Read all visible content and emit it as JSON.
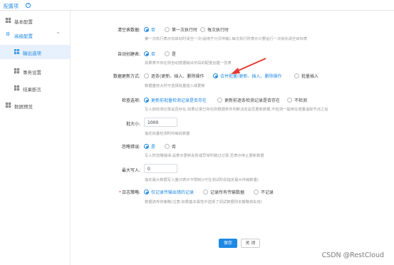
{
  "header": {
    "title": "配置项",
    "info_icon": "info-icon"
  },
  "sidebar": {
    "items": [
      {
        "label": "基本配置",
        "icon": "grid-icon"
      },
      {
        "label": "高级配置",
        "icon": "settings-icon",
        "chevron": "^"
      },
      {
        "label": "输出选项",
        "icon": "grid-icon"
      },
      {
        "label": "事务设置",
        "icon": "grid-icon"
      },
      {
        "label": "结果断言",
        "icon": "grid-icon"
      },
      {
        "label": "数据预览",
        "icon": "grid-icon"
      }
    ]
  },
  "form": {
    "truncate": {
      "label": "清空表数据:",
      "options": [
        "否",
        "第一次执行时",
        "每次执行时"
      ],
      "selected": 0,
      "hint": "第一次执行表示仅启动时清空一次(适用于分页传输),每次执行时表示只要运行一次就先清空目标表"
    },
    "auto_create": {
      "label": "自动创建表:",
      "options": [
        "否",
        "是"
      ],
      "selected": 0,
      "hint": "如果表不存在则自动根据输出字段的配置创建一张表"
    },
    "update_mode": {
      "label": "数据更新方式:",
      "options": [
        "逐条(更新、插入、删除操作",
        "合并批量(更新、插入、删除操作",
        "批量插入"
      ],
      "selected": 1,
      "hint": "数据量较大时可选择批量插入或更新"
    },
    "check_option": {
      "label": "检查选项:",
      "options": [
        "更新前批量检测记录是否存在",
        "更新前逐条检测记录是否存在",
        "不检测"
      ],
      "selected": 0,
      "hint": "写入前检测记录是否存在,如果记录已存在则根据条件判断决定是否更新数据,不检测一般用在增量追踪节点之后"
    },
    "batch_size": {
      "label": "批大小:",
      "value": "1000",
      "hint": "指定批量检测时的每批数量"
    },
    "ignore_error": {
      "label": "忽略错误:",
      "options": [
        "是",
        "否"
      ],
      "selected": 0,
      "hint": "写入时忽略错误,是表示更新失败或异常时跳过记录,否表示停止更新数据"
    },
    "max_write": {
      "label": "最大写入:",
      "value": "0",
      "hint": "指定最大数据写入量(0表示不限制)(可在测试阶段指定最大传输数量)"
    },
    "log_policy": {
      "label": "日志策略:",
      "required": "*",
      "options": [
        "仅记录传输出错的记录",
        "记录所有传输数据",
        "不记录"
      ],
      "selected": 0,
      "hint": "数据流传存策略(注意:如果基本属性中选择了调试数据则本策略将失效)"
    }
  },
  "buttons": {
    "save": "保存",
    "close": "关 闭"
  },
  "watermark": "CSDN @RestCloud",
  "colors": {
    "accent": "#1e88e5",
    "arrow": "#e53935"
  }
}
